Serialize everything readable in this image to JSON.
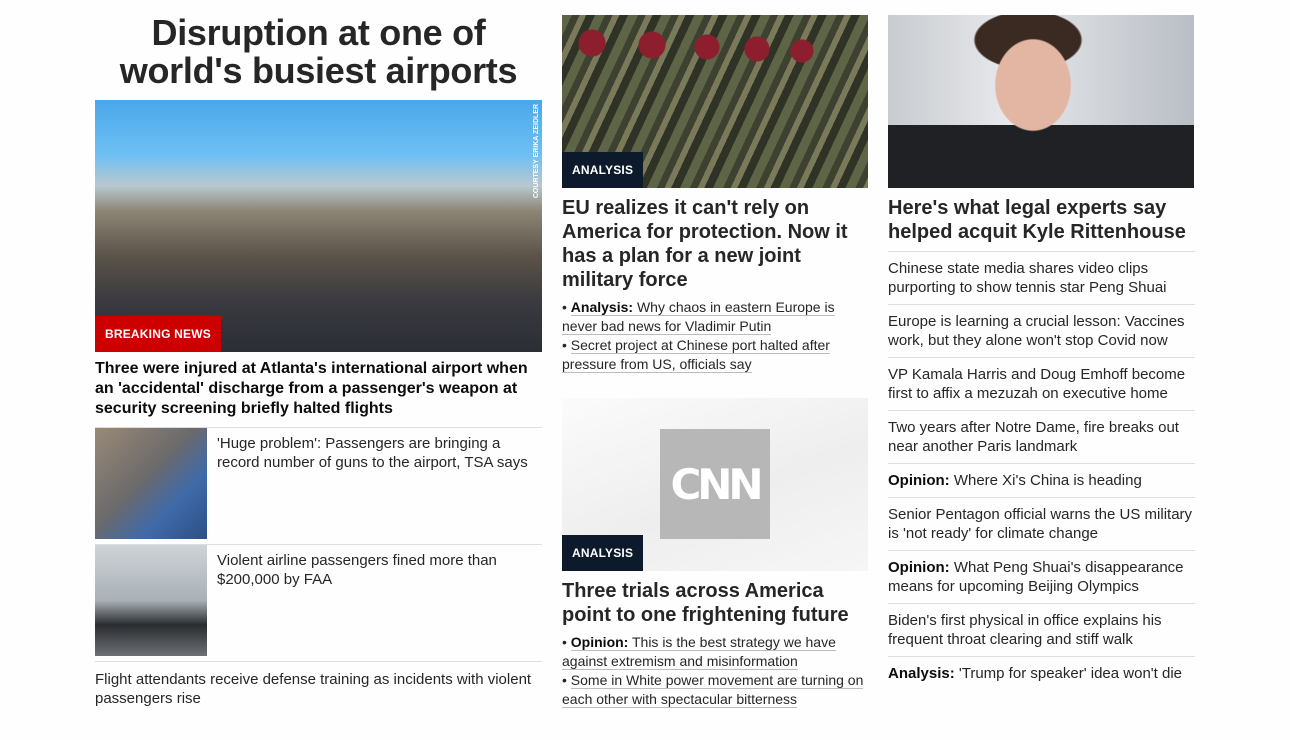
{
  "lead": {
    "title": "Disruption at one of world's busiest airports",
    "image_badge": "BREAKING NEWS",
    "image_credit": "COURTESY ERIKA ZEIDLER",
    "headline": "Three were injured at Atlanta's international airport when an 'accidental' discharge from a passenger's weapon at security screening briefly halted flights",
    "related": [
      {
        "text": "'Huge problem': Passengers are bringing a record number of guns to the airport, TSA says"
      },
      {
        "text": "Violent airline passengers fined more than $200,000 by FAA"
      }
    ],
    "extra": "Flight attendants receive defense training as incidents with violent passengers rise"
  },
  "middle": {
    "card1": {
      "badge": "ANALYSIS",
      "headline": "EU realizes it can't rely on America for protection. Now it has a plan for a new joint military force",
      "bullets": [
        {
          "prefix": "Analysis:",
          "text": "Why chaos in eastern Europe is never bad news for Vladimir Putin"
        },
        {
          "prefix": "",
          "text": "Secret project at Chinese port halted after pressure from US, officials say"
        }
      ]
    },
    "card2": {
      "badge": "ANALYSIS",
      "logo": "CNN",
      "headline": "Three trials across America point to one frightening future",
      "bullets": [
        {
          "prefix": "Opinion:",
          "text": "This is the best strategy we have against extremism and misinformation"
        },
        {
          "prefix": "",
          "text": "Some in White power movement are turning on each other with spectacular bitterness"
        }
      ]
    }
  },
  "right": {
    "headline": "Here's what legal experts say helped acquit Kyle Rittenhouse",
    "items": [
      {
        "prefix": "",
        "text": "Chinese state media shares video clips purporting to show tennis star Peng Shuai"
      },
      {
        "prefix": "",
        "text": "Europe is learning a crucial lesson: Vaccines work, but they alone won't stop Covid now"
      },
      {
        "prefix": "",
        "text": "VP Kamala Harris and Doug Emhoff become first to affix a mezuzah on executive home"
      },
      {
        "prefix": "",
        "text": "Two years after Notre Dame, fire breaks out near another Paris landmark"
      },
      {
        "prefix": "Opinion:",
        "text": "Where Xi's China is heading"
      },
      {
        "prefix": "",
        "text": "Senior Pentagon official warns the US military is 'not ready' for climate change"
      },
      {
        "prefix": "Opinion:",
        "text": "What Peng Shuai's disappearance means for upcoming Beijing Olympics"
      },
      {
        "prefix": "",
        "text": "Biden's first physical in office explains his frequent throat clearing and stiff walk"
      },
      {
        "prefix": "Analysis:",
        "text": "'Trump for speaker' idea won't die"
      }
    ]
  },
  "colors": {
    "breaking_red": "#cc0000",
    "badge_dark": "#0c1a2b"
  }
}
